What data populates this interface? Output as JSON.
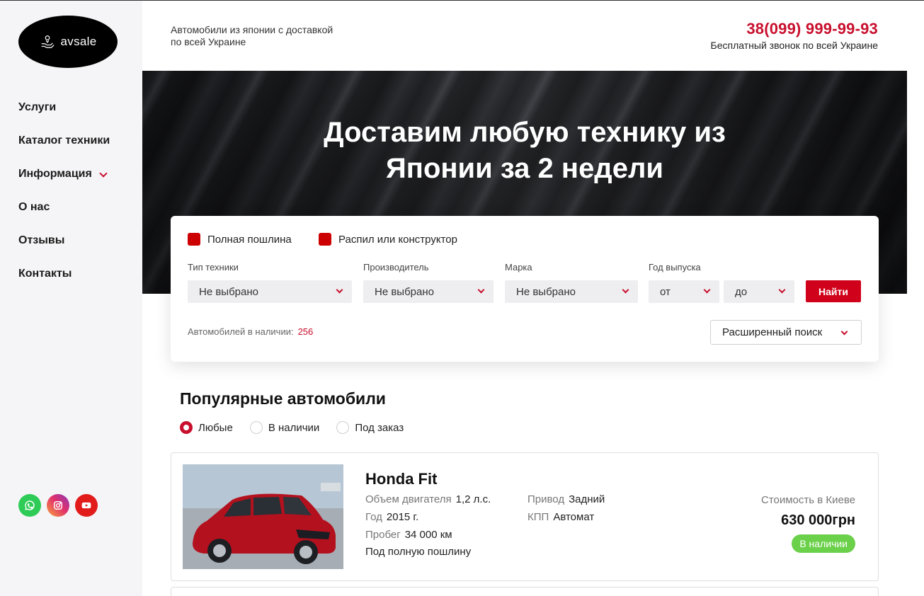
{
  "brand": {
    "logo_text": "avsale"
  },
  "header": {
    "tagline": "Автомобили из японии с доставкой по всей Украине",
    "phone": "38(099) 999-99-93",
    "phone_note": "Бесплатный звонок по всей Украине"
  },
  "sidebar": {
    "items": [
      {
        "label": "Услуги"
      },
      {
        "label": "Каталог техники"
      },
      {
        "label": "Информация",
        "has_submenu": true
      },
      {
        "label": "О нас"
      },
      {
        "label": "Отзывы"
      },
      {
        "label": "Контакты"
      }
    ],
    "socials": [
      {
        "icon": "whatsapp-icon",
        "color": "#2ecc57"
      },
      {
        "icon": "instagram-icon",
        "color": "#e1306c"
      },
      {
        "icon": "youtube-icon",
        "color": "#e21b1b"
      }
    ]
  },
  "hero": {
    "title": "Доставим любую технику из Японии за 2 недели"
  },
  "search": {
    "checkbox_full_duty": "Полная пошлина",
    "checkbox_parts": "Распил или конструктор",
    "type_label": "Тип техники",
    "type_value": "Не выбрано",
    "maker_label": "Производитель",
    "maker_value": "Не выбрано",
    "brand_label": "Марка",
    "brand_value": "Не выбрано",
    "year_label": "Год выпуска",
    "year_from": "от",
    "year_to": "до",
    "find_button": "Найти",
    "available_label": "Автомобилей в наличии:",
    "available_count": "256",
    "advanced_button": "Расширенный поиск",
    "accent_color": "#c8102e"
  },
  "popular": {
    "title": "Популярные автомобили",
    "filters": [
      {
        "label": "Любые",
        "selected": true
      },
      {
        "label": "В наличии",
        "selected": false
      },
      {
        "label": "Под заказ",
        "selected": false
      }
    ]
  },
  "car": {
    "name": "Honda Fit",
    "engine_label": "Объем двигателя",
    "engine_value": "1,2 л.с.",
    "year_label": "Год",
    "year_value": "2015 г.",
    "mileage_label": "Пробег",
    "mileage_value": "34 000 км",
    "duty_note": "Под полную пошлину",
    "drive_label": "Привод",
    "drive_value": "Задний",
    "gearbox_label": "КПП",
    "gearbox_value": "Автомат",
    "price_label": "Стоимость в Киеве",
    "price": "630 000грн",
    "status": "В наличии",
    "status_color": "#6bd04a"
  }
}
